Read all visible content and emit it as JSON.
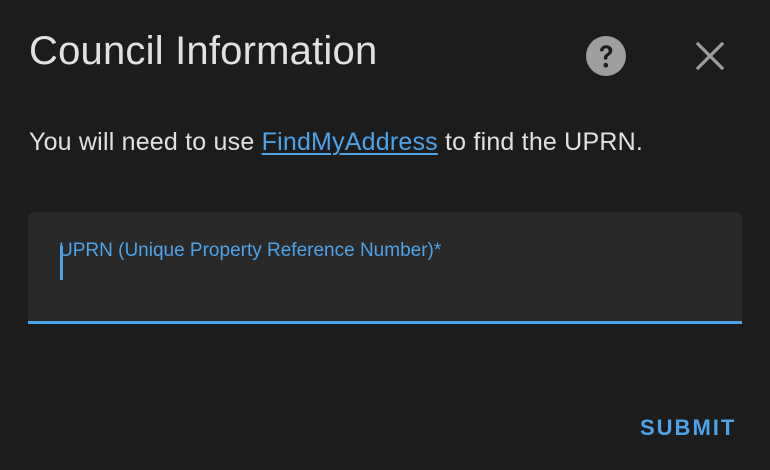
{
  "dialog": {
    "title": "Council Information",
    "help_icon": "help-circle-icon",
    "close_icon": "close-icon"
  },
  "description": {
    "prefix": "You will need to use ",
    "link_text": "FindMyAddress",
    "suffix": " to find the UPRN."
  },
  "uprn_field": {
    "label": "UPRN (Unique Property Reference Number)*",
    "value": ""
  },
  "actions": {
    "submit_label": "SUBMIT"
  },
  "colors": {
    "background": "#1c1c1c",
    "field_background": "#292929",
    "accent": "#4da3e8",
    "text": "#e1e1e1",
    "icon": "#9e9e9e"
  }
}
